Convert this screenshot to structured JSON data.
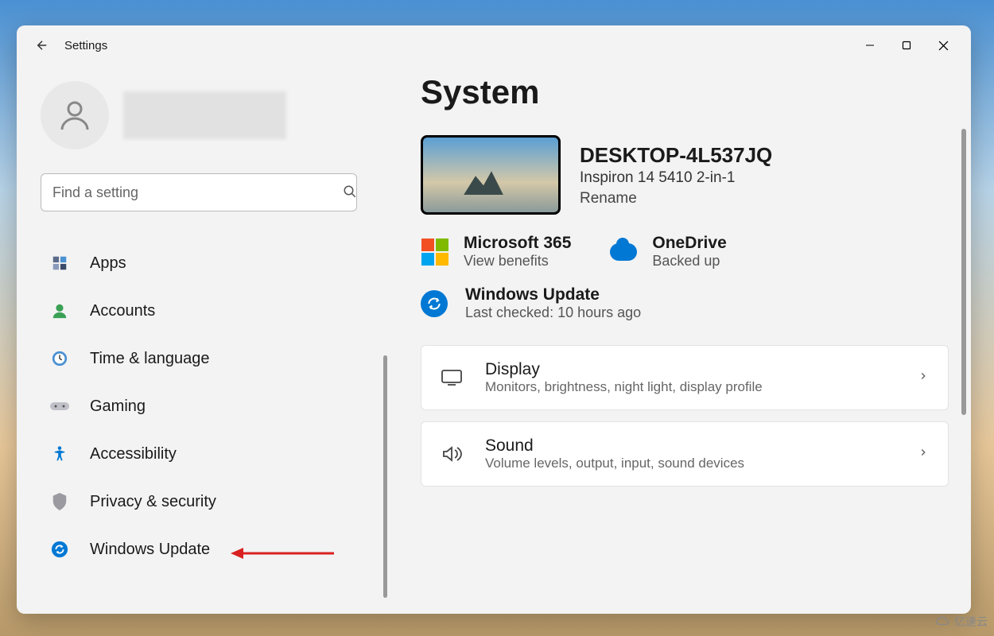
{
  "window": {
    "title": "Settings"
  },
  "search": {
    "placeholder": "Find a setting"
  },
  "sidebar": {
    "items": [
      {
        "label": "Apps",
        "icon": "apps"
      },
      {
        "label": "Accounts",
        "icon": "accounts"
      },
      {
        "label": "Time & language",
        "icon": "time"
      },
      {
        "label": "Gaming",
        "icon": "gaming"
      },
      {
        "label": "Accessibility",
        "icon": "accessibility"
      },
      {
        "label": "Privacy & security",
        "icon": "privacy"
      },
      {
        "label": "Windows Update",
        "icon": "update"
      }
    ]
  },
  "main": {
    "page_title": "System",
    "device": {
      "name": "DESKTOP-4L537JQ",
      "model": "Inspiron 14 5410 2-in-1",
      "rename_label": "Rename"
    },
    "microsoft365": {
      "title": "Microsoft 365",
      "subtitle": "View benefits"
    },
    "onedrive": {
      "title": "OneDrive",
      "subtitle": "Backed up"
    },
    "windows_update": {
      "title": "Windows Update",
      "subtitle": "Last checked: 10 hours ago"
    },
    "cards": [
      {
        "title": "Display",
        "desc": "Monitors, brightness, night light, display profile"
      },
      {
        "title": "Sound",
        "desc": "Volume levels, output, input, sound devices"
      }
    ]
  },
  "watermark": "亿速云"
}
